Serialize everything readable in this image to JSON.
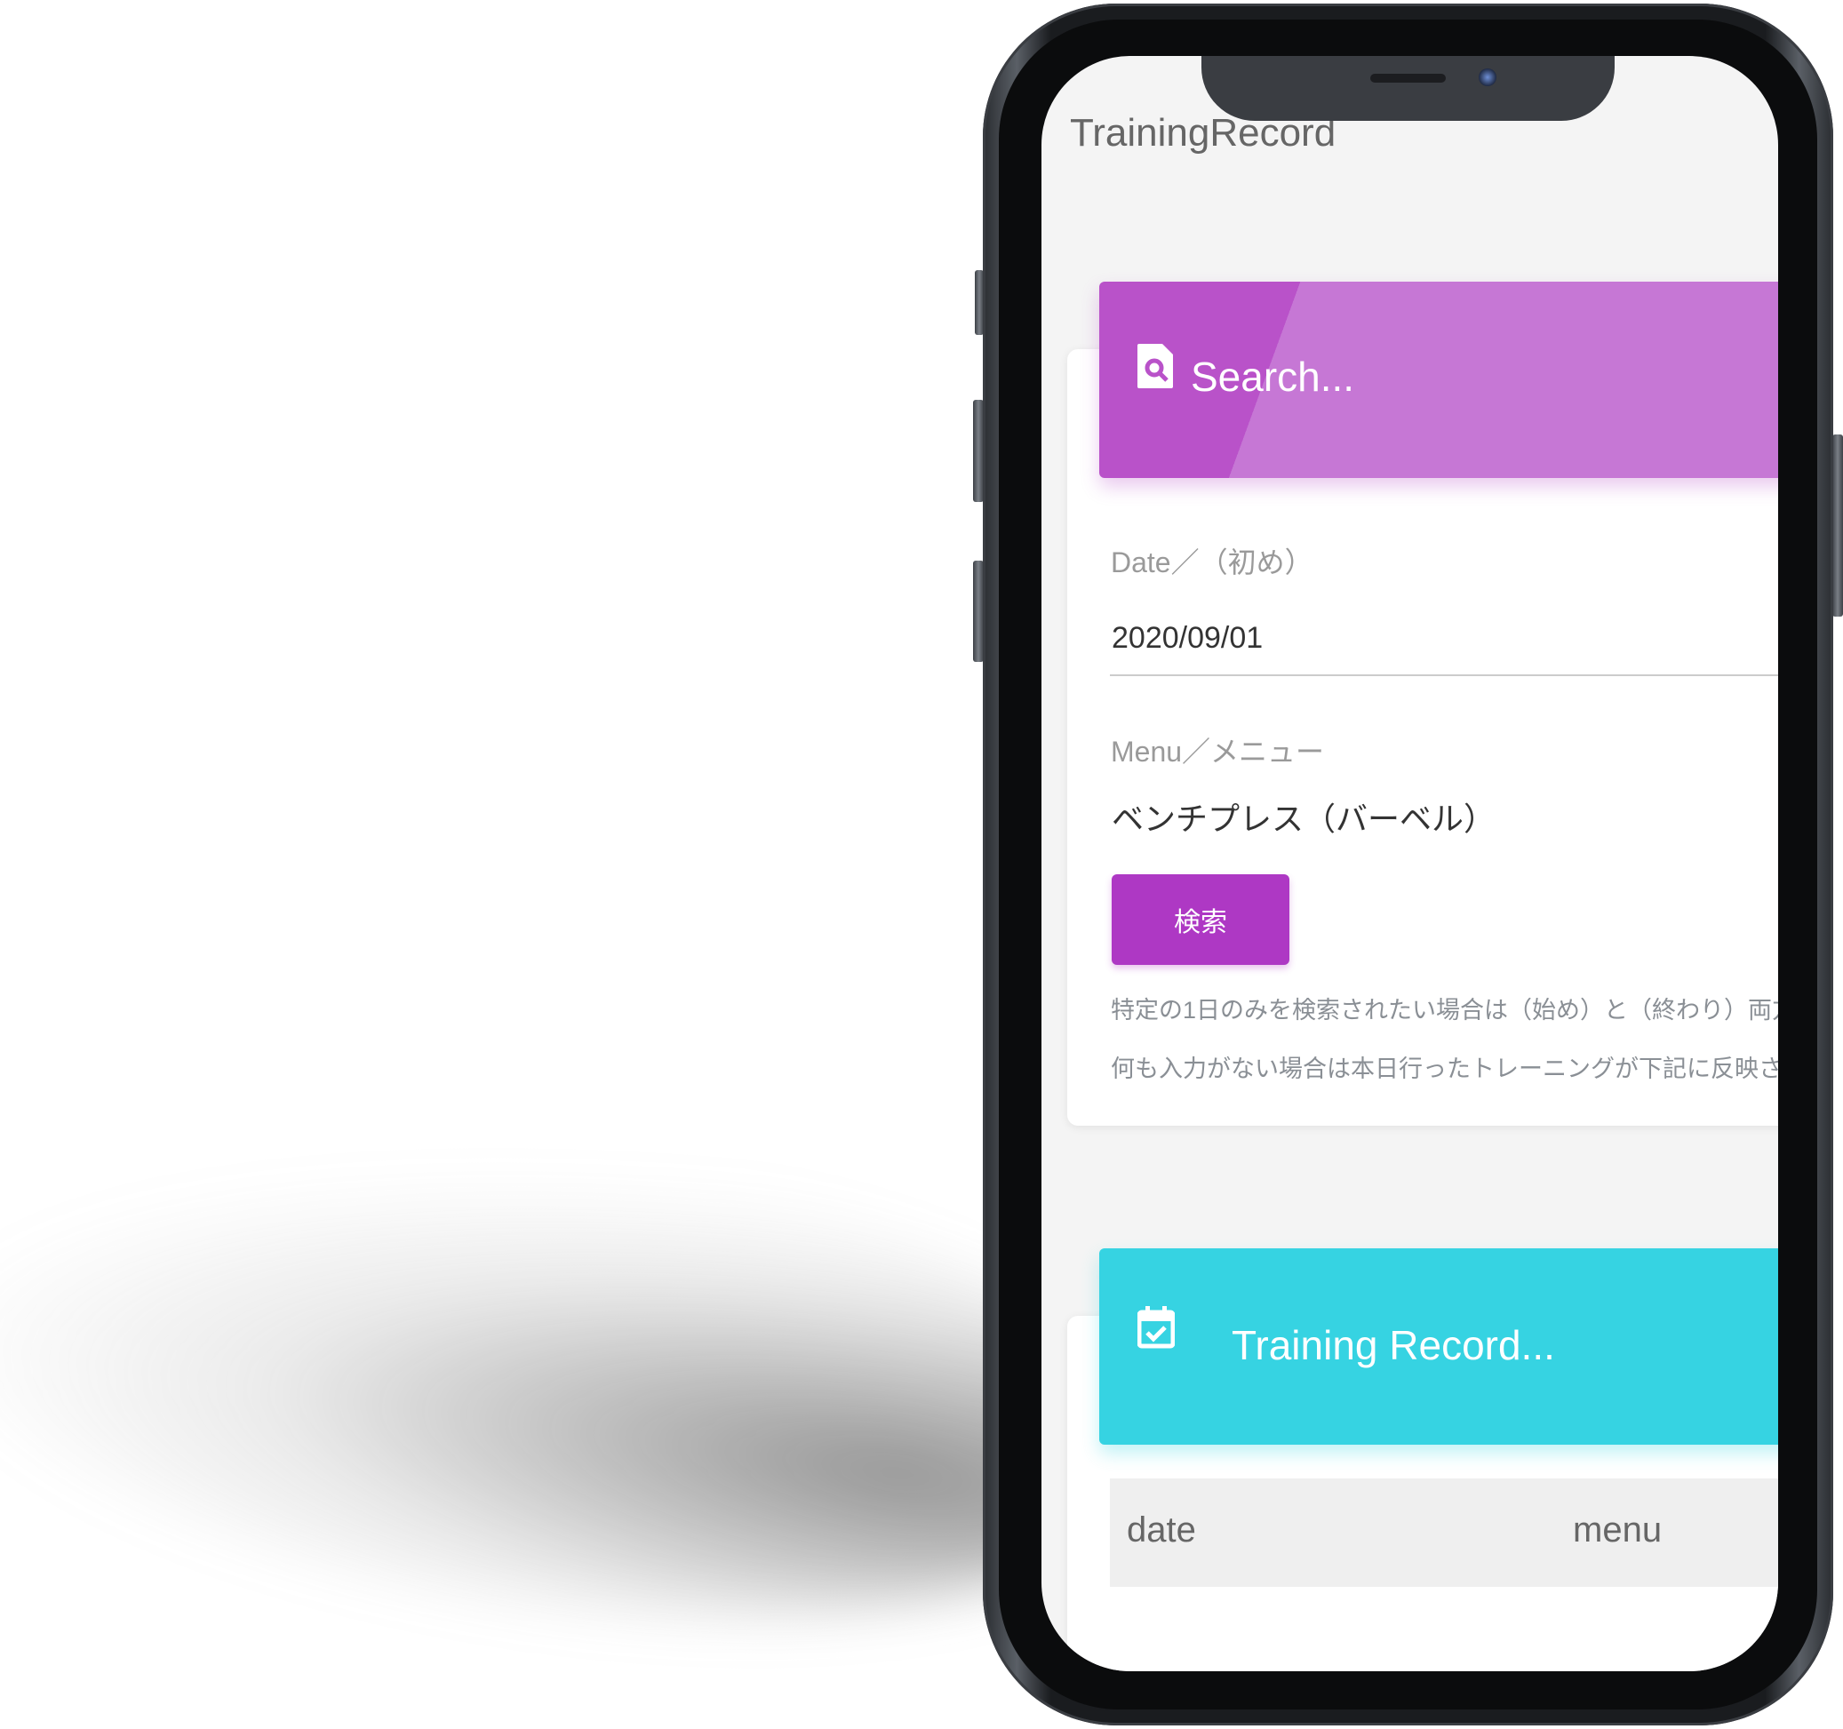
{
  "app": {
    "title": "TrainingRecord"
  },
  "search_card": {
    "header": "Search...",
    "icon": "file-search-icon",
    "date_label": "Date／（初め）",
    "date_value": "2020/09/01",
    "menu_label": "Menu／メニュー",
    "menu_value": "ベンチプレス（バーベル）",
    "search_button": "検索",
    "notes": [
      "特定の1日のみを検索されたい場合は（始め）と（終わり）両方",
      "何も入力がない場合は本日行ったトレーニングが下記に反映さ"
    ]
  },
  "record_card": {
    "header": "Training Record...",
    "icon": "calendar-check-icon",
    "columns": [
      "date",
      "menu"
    ]
  },
  "colors": {
    "search_accent": "#b952c9",
    "button": "#ae38c4",
    "record_accent": "#36d3e2"
  }
}
